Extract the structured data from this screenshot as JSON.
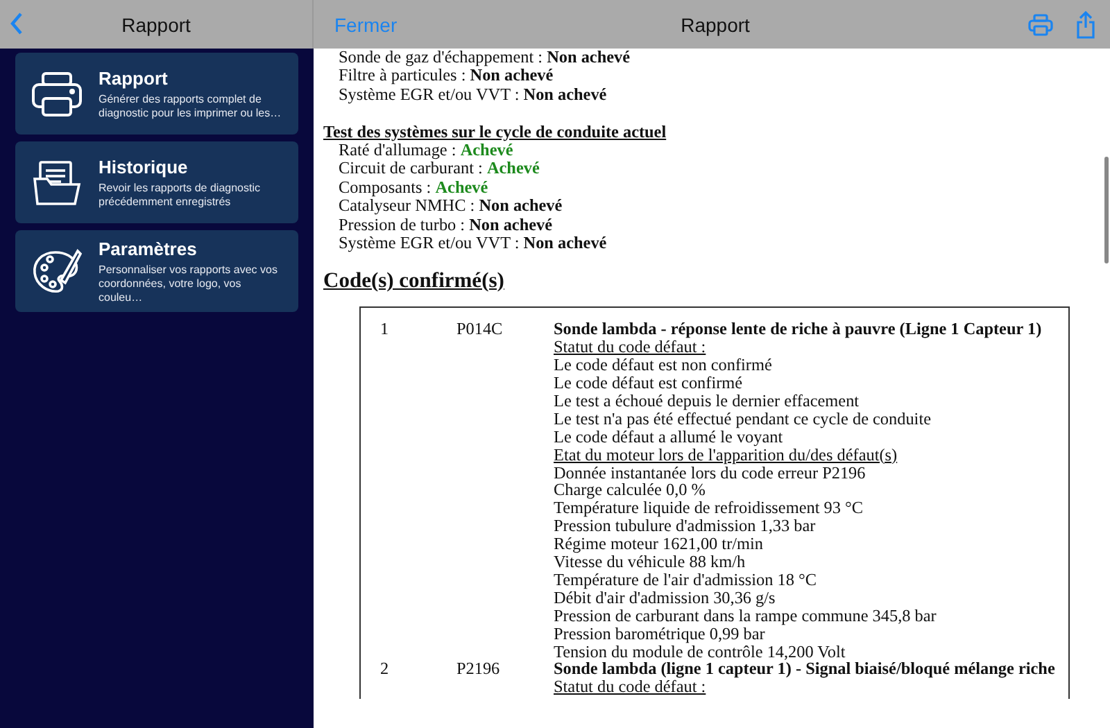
{
  "sidebar": {
    "title": "Rapport",
    "items": [
      {
        "kind": "printer",
        "title": "Rapport",
        "description": "Générer des rapports complet de diagnostic pour les imprimer ou les…"
      },
      {
        "kind": "folder",
        "title": "Historique",
        "description": "Revoir les rapports de diagnostic précédemment enregistrés"
      },
      {
        "kind": "palette",
        "title": "Paramètres",
        "description": "Personnaliser vos rapports avec vos coordonnées, votre logo, vos couleu…"
      }
    ]
  },
  "report": {
    "close_label": "Fermer",
    "title": "Rapport",
    "sections": [
      {
        "items": [
          {
            "label": "Sonde de gaz d'échappement :",
            "status": "Non achevé",
            "kind": "pending"
          },
          {
            "label": "Filtre à particules :",
            "status": "Non achevé",
            "kind": "pending"
          },
          {
            "label": "Système EGR et/ou VVT :",
            "status": "Non achevé",
            "kind": "pending"
          }
        ]
      },
      {
        "heading": "Test des systèmes sur le cycle de conduite actuel",
        "items": [
          {
            "label": "Raté d'allumage :",
            "status": "Achevé",
            "kind": "done"
          },
          {
            "label": "Circuit de carburant :",
            "status": "Achevé",
            "kind": "done"
          },
          {
            "label": "Composants :",
            "status": "Achevé",
            "kind": "done"
          },
          {
            "label": "Catalyseur NMHC :",
            "status": "Non achevé",
            "kind": "pending"
          },
          {
            "label": "Pression de turbo :",
            "status": "Non achevé",
            "kind": "pending"
          },
          {
            "label": "Système EGR et/ou VVT :",
            "status": "Non achevé",
            "kind": "pending"
          }
        ]
      }
    ],
    "codes_heading": "Code(s) confirmé(s)",
    "codes": [
      {
        "number": "1",
        "code": "P014C",
        "title": "Sonde lambda - réponse lente de riche à pauvre (Ligne 1 Capteur 1)",
        "lines": [
          {
            "kind": "heading",
            "text": "Statut du code défaut :"
          },
          {
            "kind": "text",
            "text": "Le code défaut est non confirmé"
          },
          {
            "kind": "text",
            "text": "Le code défaut est confirmé"
          },
          {
            "kind": "text",
            "text": "Le test a échoué depuis le dernier effacement"
          },
          {
            "kind": "text",
            "text": "Le test n'a pas été effectué pendant ce cycle de conduite"
          },
          {
            "kind": "text",
            "text": "Le code défaut a allumé le voyant"
          },
          {
            "kind": "heading",
            "text": "Etat du moteur lors de l'apparition du/des défaut(s)"
          },
          {
            "kind": "text",
            "text": "Donnée instantanée lors du code erreur P2196"
          },
          {
            "kind": "text",
            "text": "Charge calculée 0,0 %"
          },
          {
            "kind": "text",
            "text": "Température liquide de refroidissement 93 °C"
          },
          {
            "kind": "text",
            "text": "Pression tubulure d'admission 1,33 bar"
          },
          {
            "kind": "text",
            "text": "Régime moteur 1621,00 tr/min"
          },
          {
            "kind": "text",
            "text": "Vitesse du véhicule 88 km/h"
          },
          {
            "kind": "text",
            "text": "Température de l'air d'admission 18 °C"
          },
          {
            "kind": "text",
            "text": "Débit d'air d'admission 30,36 g/s"
          },
          {
            "kind": "text",
            "text": "Pression de carburant dans la rampe commune 345,8 bar"
          },
          {
            "kind": "text",
            "text": "Pression barométrique 0,99 bar"
          },
          {
            "kind": "text",
            "text": "Tension du module de contrôle 14,200 Volt"
          }
        ]
      },
      {
        "number": "2",
        "code": "P2196",
        "title": "Sonde lambda (ligne 1 capteur 1) - Signal biaisé/bloqué mélange riche",
        "lines": [
          {
            "kind": "heading",
            "text": "Statut du code défaut :"
          }
        ]
      }
    ]
  }
}
